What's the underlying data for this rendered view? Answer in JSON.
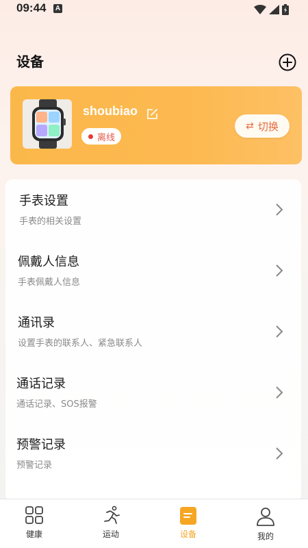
{
  "status_bar": {
    "time": "09:44",
    "notification_letter": "A"
  },
  "header": {
    "title": "设备"
  },
  "device": {
    "name": "shoubiao",
    "status": "离线",
    "switch_label": "切换",
    "switch_icon": "⇄"
  },
  "menu": {
    "items": [
      {
        "title": "手表设置",
        "subtitle": "手表的相关设置"
      },
      {
        "title": "佩戴人信息",
        "subtitle": "手表佩戴人信息"
      },
      {
        "title": "通讯录",
        "subtitle": "设置手表的联系人、紧急联系人"
      },
      {
        "title": "通话记录",
        "subtitle": "通话记录、SOS报警"
      },
      {
        "title": "预警记录",
        "subtitle": "预警记录"
      }
    ]
  },
  "tabs": [
    {
      "label": "健康",
      "icon": "grid-icon"
    },
    {
      "label": "运动",
      "icon": "running-icon"
    },
    {
      "label": "设备",
      "icon": "device-icon",
      "active": true
    },
    {
      "label": "我的",
      "icon": "profile-icon"
    }
  ],
  "colors": {
    "accent": "#fbb84a",
    "active_tab": "#f5a623",
    "offline_dot": "#e53b35"
  }
}
